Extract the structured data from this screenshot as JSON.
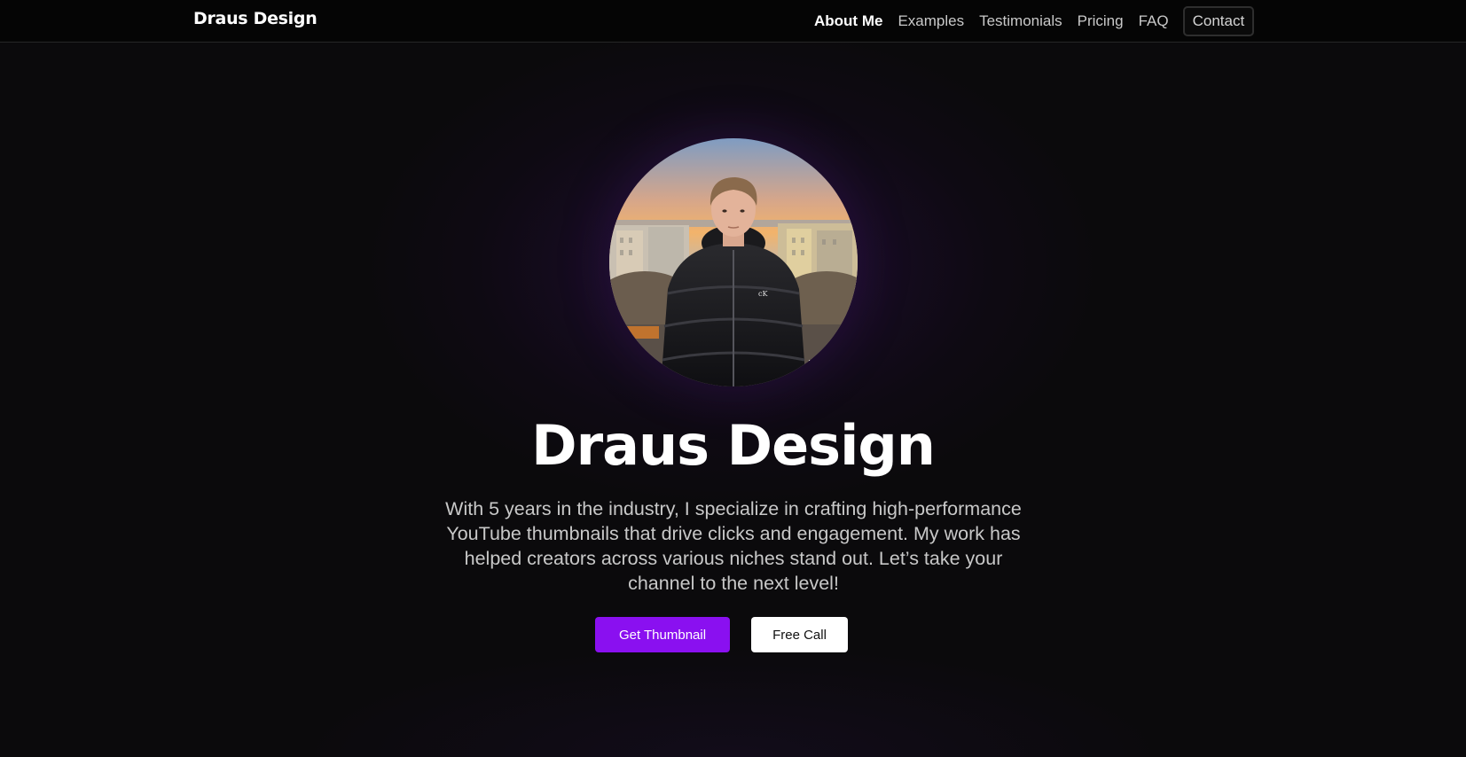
{
  "header": {
    "brand": "Draus Design",
    "nav": [
      {
        "label": "About Me",
        "active": true
      },
      {
        "label": "Examples",
        "active": false
      },
      {
        "label": "Testimonials",
        "active": false
      },
      {
        "label": "Pricing",
        "active": false
      },
      {
        "label": "FAQ",
        "active": false
      }
    ],
    "contact_label": "Contact"
  },
  "hero": {
    "avatar_icon": "profile-photo",
    "title": "Draus Design",
    "description": "With 5 years in the industry, I specialize in crafting high-performance YouTube thumbnails that drive clicks and engagement. My work has helped creators across various niches stand out. Let’s take your channel to the next level!",
    "primary_cta": "Get Thumbnail",
    "secondary_cta": "Free Call"
  },
  "colors": {
    "background": "#0b0a0c",
    "navbar": "#050505",
    "accent": "#8a10f0",
    "text": "#ffffff",
    "muted_text": "#c8c8c8"
  }
}
